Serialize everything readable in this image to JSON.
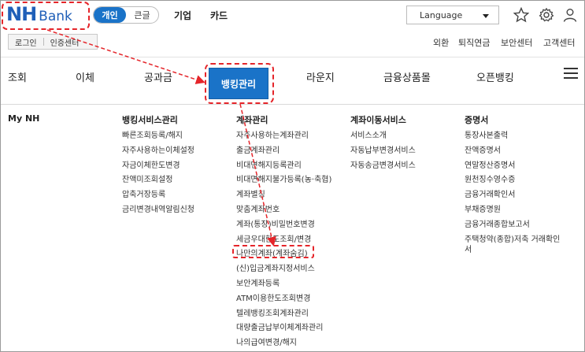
{
  "logo": {
    "nh": "NH",
    "bank": "Bank"
  },
  "segment": {
    "items": [
      "개인",
      "큰글"
    ],
    "active": "개인"
  },
  "top_links": [
    "기업",
    "카드"
  ],
  "language": {
    "value": "Language"
  },
  "icons": {
    "favorite": "star-icon",
    "settings": "gear-icon",
    "user": "user-icon"
  },
  "login": {
    "login_label": "로그인",
    "cert_label": "인증센터"
  },
  "util_links": [
    "외환",
    "퇴직연금",
    "보안센터",
    "고객센터"
  ],
  "nav": {
    "items": [
      "조회",
      "이체",
      "공과금",
      "뱅킹관리",
      "라운지",
      "금융상품몰",
      "오픈뱅킹"
    ],
    "active": "뱅킹관리"
  },
  "menu": {
    "columns": [
      {
        "title": "My NH",
        "items": []
      },
      {
        "title": "뱅킹서비스관리",
        "items": [
          "빠른조회등록/해지",
          "자주사용하는이체설정",
          "자금이체한도변경",
          "잔액미조회설정",
          "압축거장등록",
          "금리변경내역알림신청"
        ]
      },
      {
        "title": "계좌관리",
        "items": [
          "자주사용하는계좌관리",
          "출금계좌관리",
          "비대면해지등록관리",
          "비대면해지불가등록(농·축협)",
          "계좌별칭",
          "맞춤계좌번호",
          "계좌(통장)비밀번호변경",
          "세금우대한도조회/변경",
          "나만의계좌(계좌숨김)",
          "(신)입금계좌지정서비스",
          "보안계좌등록",
          "ATM이용한도조회변경",
          "텔레뱅킹조회계좌관리",
          "대량출금납부이체계좌관리",
          "나의급여변경/해지"
        ]
      },
      {
        "title": "계좌이동서비스",
        "items": [
          "서비스소개",
          "자동납부변경서비스",
          "자동송금변경서비스"
        ]
      },
      {
        "title": "증명서",
        "items": [
          "통장사본출력",
          "잔액증명서",
          "연말정산증명서",
          "원천징수영수증",
          "금융거래확인서",
          "부채증명원",
          "금융거래종합보고서",
          "주택청약(종합)저축 거래확인서"
        ]
      }
    ],
    "highlighted": "나만의계좌(계좌숨김)"
  },
  "accent_colors": {
    "brand": "#1f5fb8",
    "active": "#1a73c8",
    "annotation": "#e5252a"
  }
}
